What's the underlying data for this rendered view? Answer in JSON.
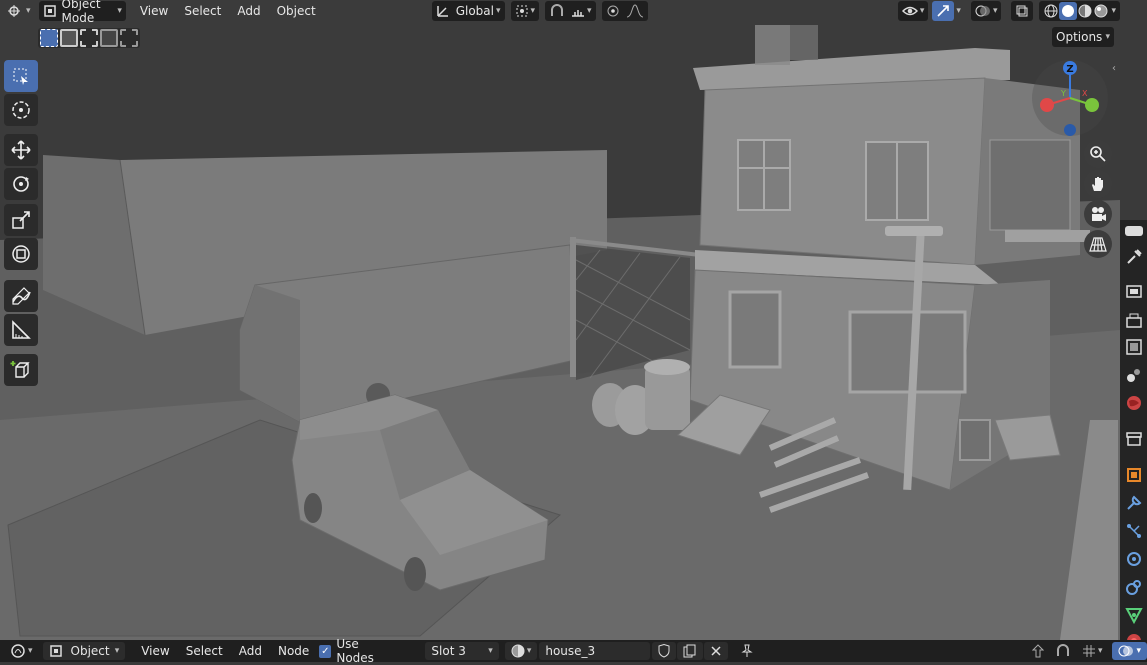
{
  "header": {
    "mode_label": "Object Mode",
    "menus": [
      "View",
      "Select",
      "Add",
      "Object"
    ],
    "transform_orientation": "Global",
    "options_label": "Options"
  },
  "footer": {
    "editor_mode": "Object",
    "menus": [
      "View",
      "Select",
      "Add",
      "Node"
    ],
    "use_nodes_label": "Use Nodes",
    "use_nodes_checked": true,
    "slot_label": "Slot 3",
    "material_name": "house_3"
  },
  "gizmo": {
    "z": "Z",
    "y": "Y",
    "x": "X"
  },
  "colors": {
    "accent": "#4a6fb0",
    "axis_x": "#e04848",
    "axis_y": "#7ac43c",
    "axis_z": "#3a7be0"
  },
  "icons": {
    "toolbar": [
      "select-box-icon",
      "cursor-icon",
      "move-icon",
      "rotate-icon",
      "scale-icon",
      "transform-icon",
      "annotate-icon",
      "measure-icon",
      "add-cube-icon"
    ],
    "nav": [
      "zoom-icon",
      "pan-hand-icon",
      "camera-icon",
      "grid-perspective-icon"
    ]
  }
}
